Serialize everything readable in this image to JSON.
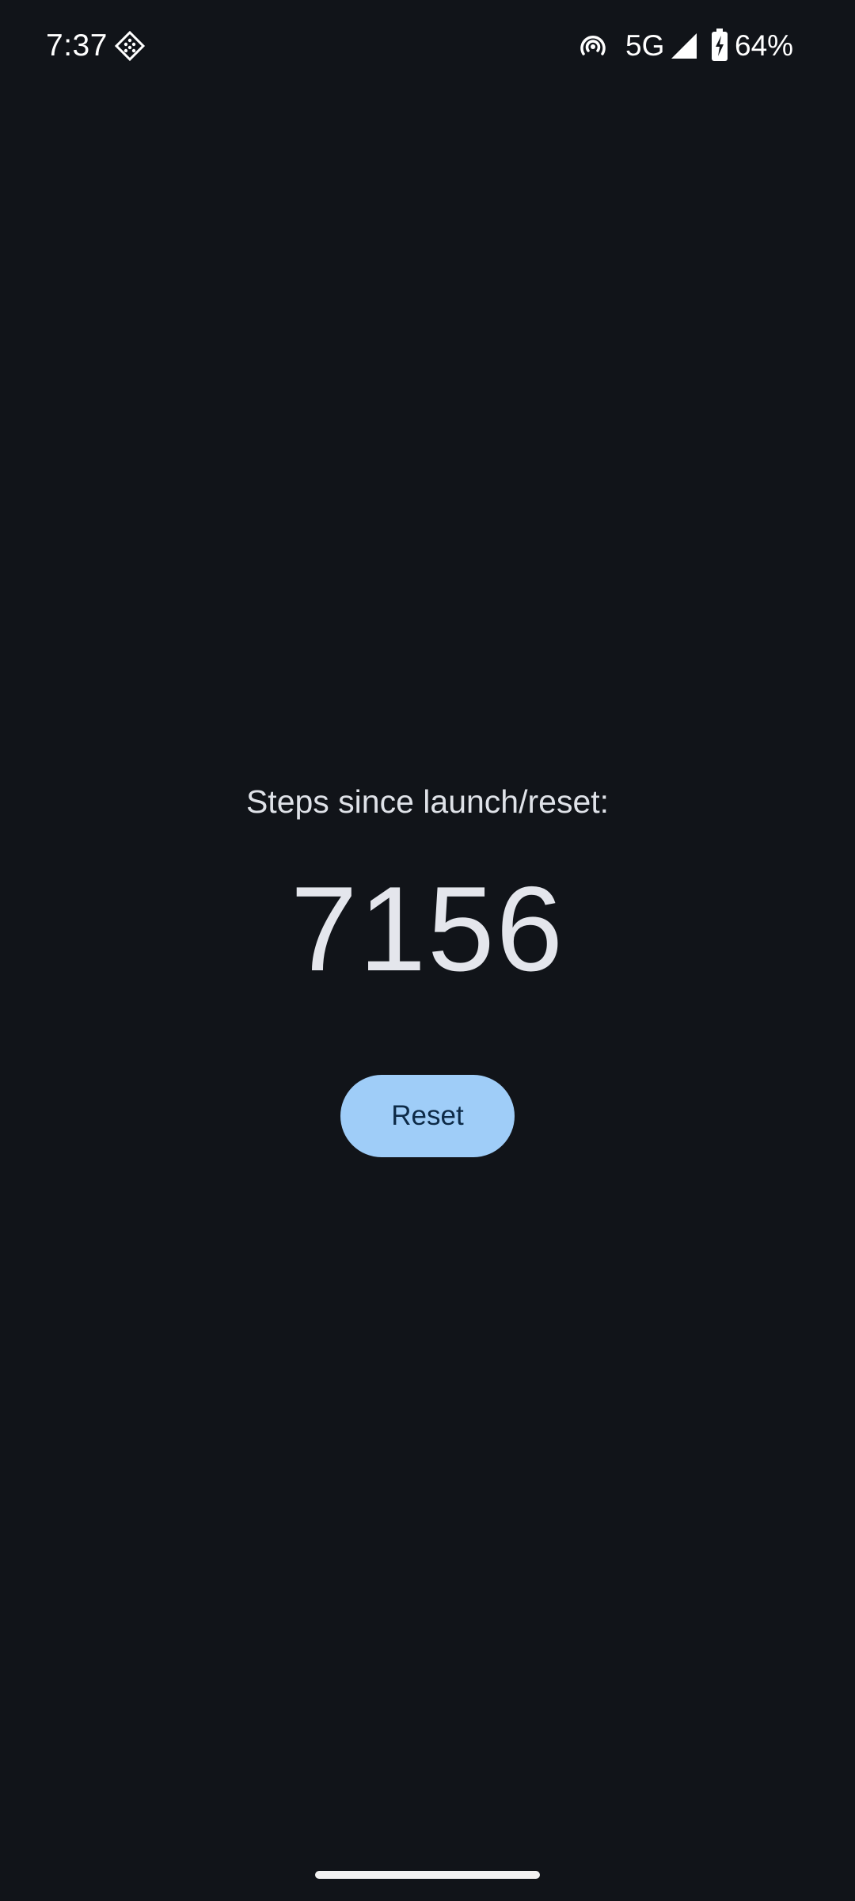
{
  "status_bar": {
    "time": "7:37",
    "network": "5G",
    "battery_percent": "64%",
    "icons": [
      "notification-diamond-icon",
      "hotspot-icon",
      "signal-icon",
      "battery-charging-icon"
    ]
  },
  "main": {
    "label": "Steps since launch/reset:",
    "step_count": "7156",
    "reset_label": "Reset"
  },
  "colors": {
    "background": "#111419",
    "text": "#e3e5ea",
    "button_bg": "#9fcdf8",
    "button_text": "#0d2a47"
  }
}
